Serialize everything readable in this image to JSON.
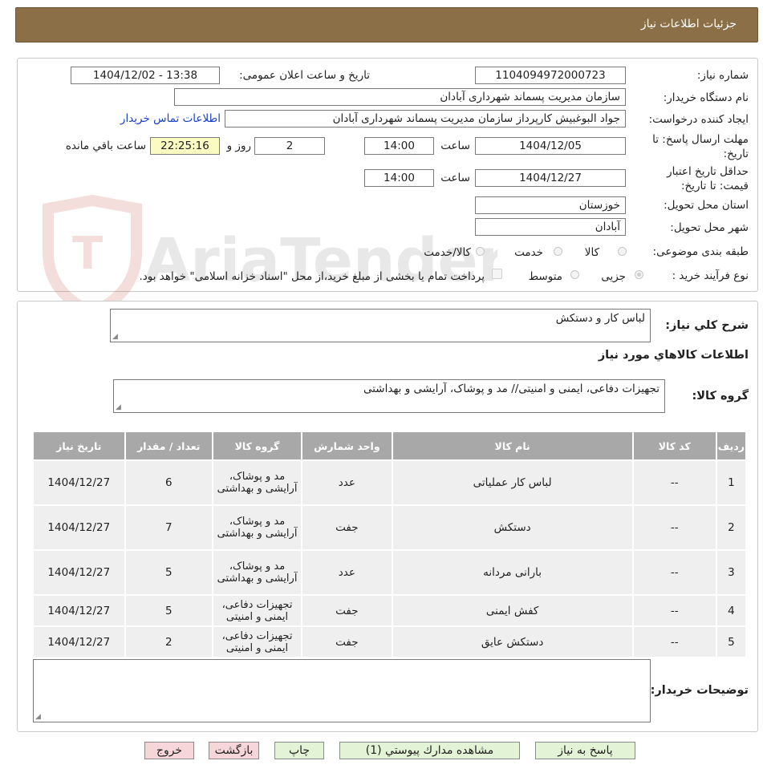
{
  "header": {
    "title": "جزئیات اطلاعات نیاز"
  },
  "watermark": {
    "text": "AriaTender.neT"
  },
  "form": {
    "need_number_label": "شماره نیاز:",
    "need_number": "1104094972000723",
    "announce_label": "تاریخ و ساعت اعلان عمومی:",
    "announce_value": "1404/12/02 - 13:38",
    "buyer_org_label": "نام دستگاه خریدار:",
    "buyer_org": "سازمان مدیریت پسماند شهرداری آبادان",
    "requester_label": "ایجاد کننده درخواست:",
    "requester": "جواد البوغبیش کارپرداز سازمان مدیریت پسماند شهرداری آبادان",
    "contact_link": "اطلاعات تماس خریدار",
    "deadline_label_1": "مهلت ارسال پاسخ: تا",
    "deadline_label_2": "تاریخ:",
    "deadline_date": "1404/12/05",
    "time_label": "ساعت",
    "deadline_time": "14:00",
    "days_value": "2",
    "days_label": "روز و",
    "remaining_value": "22:25:16",
    "remaining_label": "ساعت باقي مانده",
    "validity_label_1": "حداقل تاریخ اعتبار",
    "validity_label_2": "قیمت: تا تاریخ:",
    "validity_date": "1404/12/27",
    "validity_time": "14:00",
    "province_label": "استان محل تحویل:",
    "province": "خوزستان",
    "city_label": "شهر محل تحویل:",
    "city": "آبادان",
    "category_label": "طبقه بندی موضوعی:",
    "category_options": [
      "کالا",
      "خدمت",
      "کالا/خدمت"
    ],
    "process_label": "نوع فرآیند خرید :",
    "process_options": [
      "جزیی",
      "متوسط"
    ],
    "payment_note": "پرداخت تمام یا بخشی از مبلغ خرید،از محل \"اسناد خزانه اسلامی\" خواهد بود."
  },
  "need": {
    "summary_label": "شرح كلي نياز:",
    "summary": "لباس کار و دستکش",
    "goods_info_title": "اطلاعات كالاهاي مورد نياز",
    "goods_group_label": "گروه کالا:",
    "goods_group": "تجهیزات دفاعی، ایمنی و امنیتی// مد و پوشاک، آرایشی و بهداشتی"
  },
  "table": {
    "headers": [
      "رديف",
      "كد كالا",
      "نام كالا",
      "واحد شمارش",
      "گروه کالا",
      "تعداد / مقدار",
      "تاريخ نياز"
    ],
    "rows": [
      {
        "row": "1",
        "code": "--",
        "name": "لباس کار عملیاتی",
        "unit": "عدد",
        "group": "مد و پوشاک، آرایشی و بهداشتی",
        "qty": "6",
        "date": "1404/12/27"
      },
      {
        "row": "2",
        "code": "--",
        "name": "دستکش",
        "unit": "جفت",
        "group": "مد و پوشاک، آرایشی و بهداشتی",
        "qty": "7",
        "date": "1404/12/27"
      },
      {
        "row": "3",
        "code": "--",
        "name": "بارانی مردانه",
        "unit": "عدد",
        "group": "مد و پوشاک، آرایشی و بهداشتی",
        "qty": "5",
        "date": "1404/12/27"
      },
      {
        "row": "4",
        "code": "--",
        "name": "کفش ایمنی",
        "unit": "جفت",
        "group": "تجهیزات دفاعی، ایمنی و امنیتی",
        "qty": "5",
        "date": "1404/12/27"
      },
      {
        "row": "5",
        "code": "--",
        "name": "دستکش عایق",
        "unit": "جفت",
        "group": "تجهیزات دفاعی، ایمنی و امنیتی",
        "qty": "2",
        "date": "1404/12/27"
      }
    ]
  },
  "buyer_notes": {
    "label": "توضيحات خريدار:",
    "value": ""
  },
  "buttons": {
    "reply": "پاسخ به نیاز",
    "view_docs": "مشاهده مدارك پيوستي (1)",
    "print": "چاپ",
    "back": "بازگشت",
    "exit": "خروج"
  },
  "colors": {
    "header_bg": "#8b6f46",
    "table_header_bg": "#a8a8a8",
    "highlight_bg": "#fafac3",
    "link": "#1a3fc6"
  }
}
